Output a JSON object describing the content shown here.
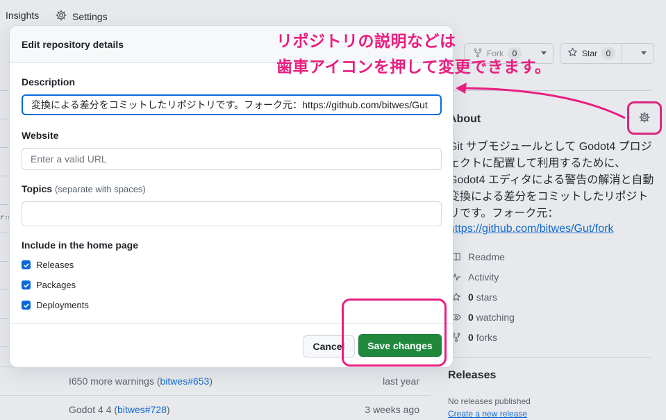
{
  "topnav": {
    "insights_label": "Insights",
    "settings_label": "Settings"
  },
  "left_strip": {
    "mono_text": "r:m"
  },
  "commits": [
    {
      "message": "I650 more warnings (",
      "link": "bitwes#653",
      "suffix": ")",
      "when": "last year"
    },
    {
      "message": "Godot 4 4 (",
      "link": "bitwes#728",
      "suffix": ")",
      "when": "3 weeks ago"
    }
  ],
  "sidebar": {
    "fork_label": "Fork",
    "fork_count": "0",
    "star_label": "Star",
    "star_count": "0",
    "about_title": "About",
    "about_description": "Git サブモジュールとして Godot4 プロジェクトに配置して利用するために、Godot4 エディタによる警告の解消と自動変換による差分をコミットしたリポジトリです。フォーク元：",
    "about_link": "https://github.com/bitwes/Gut/fork",
    "meta": [
      {
        "icon": "book-icon",
        "count": "",
        "label": "Readme"
      },
      {
        "icon": "pulse-icon",
        "count": "",
        "label": "Activity"
      },
      {
        "icon": "star-icon",
        "count": "0",
        "label": "stars"
      },
      {
        "icon": "eye-icon",
        "count": "0",
        "label": "watching"
      },
      {
        "icon": "fork-icon",
        "count": "0",
        "label": "forks"
      }
    ],
    "releases_title": "Releases",
    "releases_none": "No releases published",
    "releases_create": "Create a new release"
  },
  "annotation": {
    "line1": "リポジトリの説明などは",
    "line2": "歯車アイコンを押して変更できます。",
    "color": "#e91e80"
  },
  "modal": {
    "title": "Edit repository details",
    "description_label": "Description",
    "description_value": "変換による差分をコミットしたリポジトリです。フォーク元：https://github.com/bitwes/Gut",
    "website_label": "Website",
    "website_placeholder": "Enter a valid URL",
    "topics_label": "Topics",
    "topics_note": "(separate with spaces)",
    "include_label": "Include in the home page",
    "checkboxes": [
      {
        "label": "Releases",
        "checked": true
      },
      {
        "label": "Packages",
        "checked": true
      },
      {
        "label": "Deployments",
        "checked": true
      }
    ],
    "cancel_label": "Cancel",
    "save_label": "Save changes",
    "save_color": "#1f883d"
  }
}
